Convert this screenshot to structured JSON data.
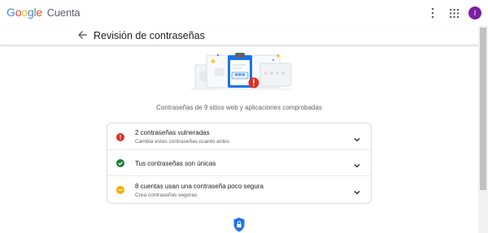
{
  "app": {
    "logo_text": "Google",
    "product": "Cuenta",
    "avatar_initial": "I",
    "avatar_color": "#7b1fa2"
  },
  "page": {
    "title": "Revisión de contraseñas"
  },
  "hero": {
    "password_mask": "***",
    "icon": "clipboard-password-illustration"
  },
  "summary": "Contraseñas de 9 sitios web y aplicaciones comprobadas",
  "checks": [
    {
      "title": "2 contraseñas vulneradas",
      "subtitle": "Cambia estas contraseñas cuanto antes",
      "status": "danger",
      "status_color": "#d93025",
      "icon": "alert-circle-icon"
    },
    {
      "title": "Tus contraseñas son únicas",
      "subtitle": "",
      "status": "ok",
      "status_color": "#188038",
      "icon": "check-circle-icon"
    },
    {
      "title": "8 cuentas usan una contraseña poco segura",
      "subtitle": "Crea contraseñas seguras",
      "status": "warning",
      "status_color": "#f9ab00",
      "icon": "warning-circle-icon"
    }
  ],
  "colors": {
    "primary_blue": "#1a73e8",
    "divider": "#dadce0"
  }
}
